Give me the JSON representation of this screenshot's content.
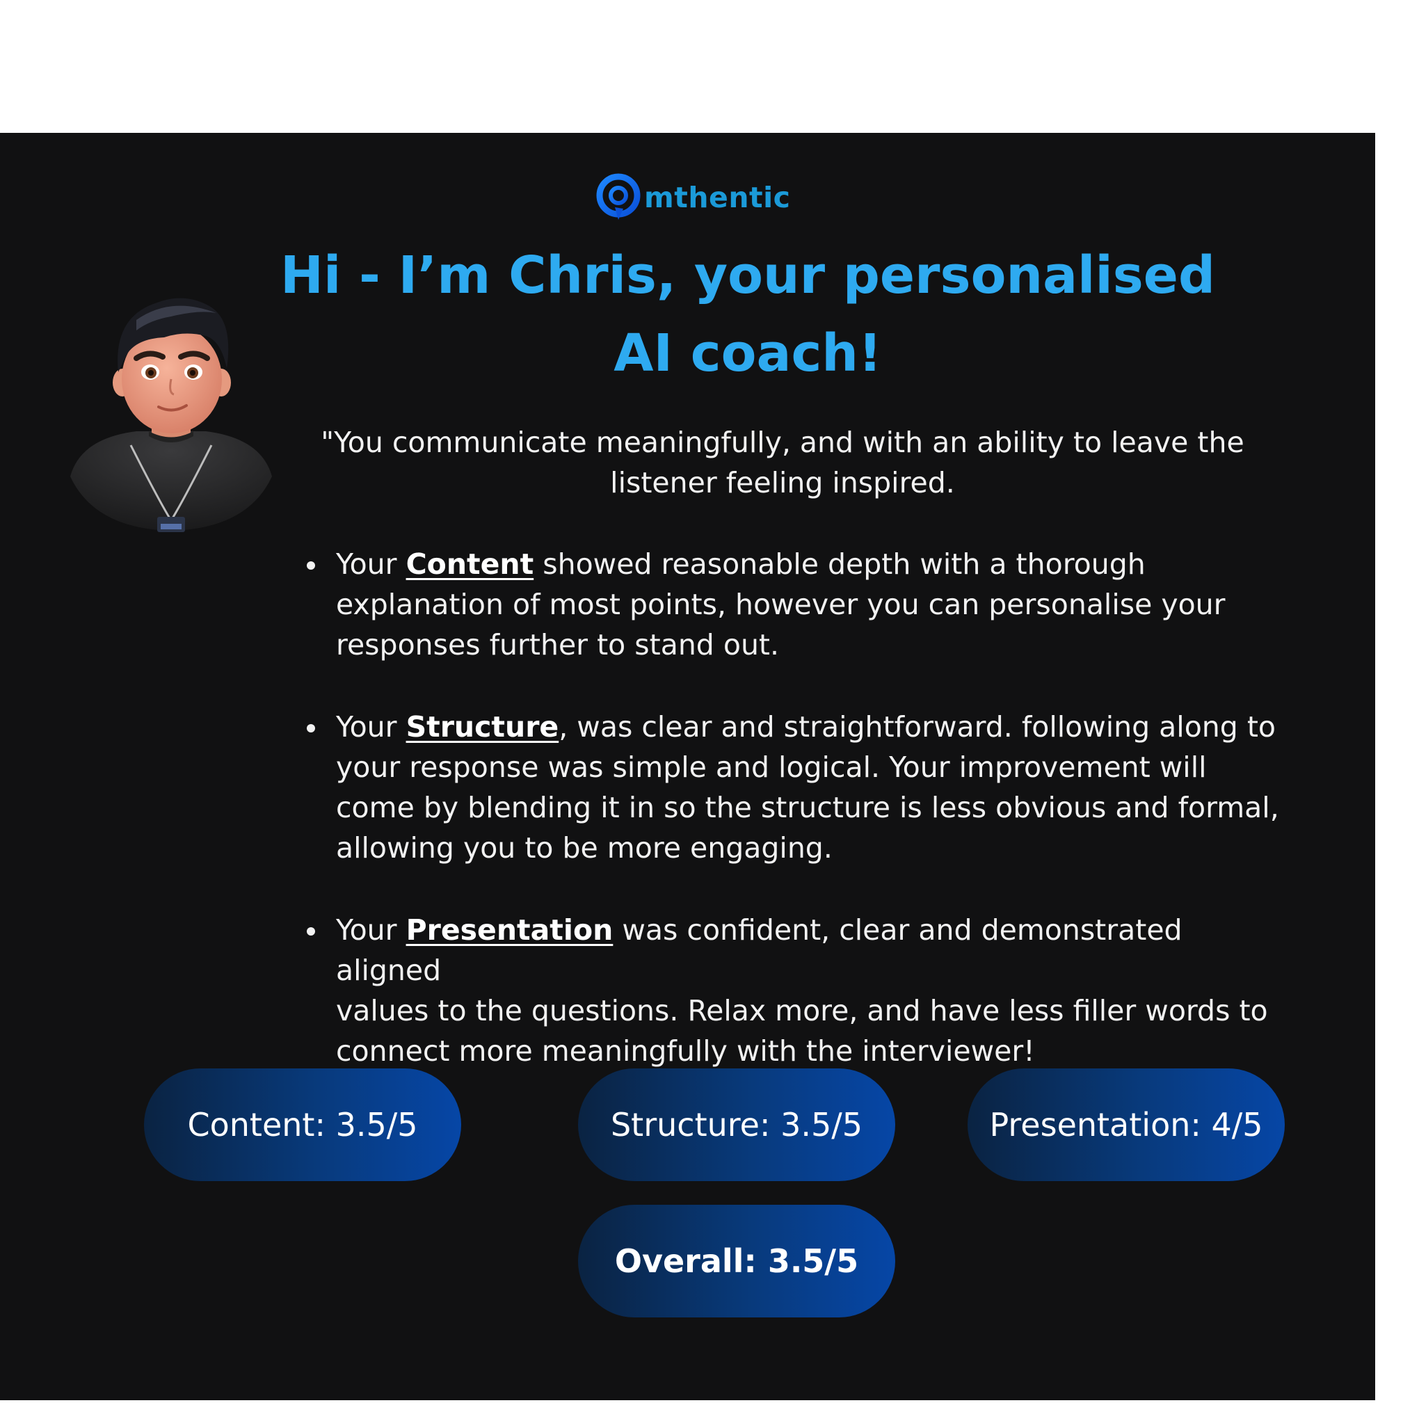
{
  "brand": {
    "name": "mthentic",
    "color": "#1b9ad8"
  },
  "headline": {
    "line1": "Hi - I’m Chris, your personalised",
    "line2": "AI coach!",
    "color": "#2eaaf0"
  },
  "quote": {
    "line1": "\"You communicate meaningfully, and with an ability to leave the",
    "line2": "listener feeling inspired."
  },
  "feedback": [
    {
      "lead": "Your ",
      "keyword": "Content",
      "lines": [
        " showed reasonable depth with a thorough",
        "explanation of most points, however you can personalise your",
        "responses further to stand out."
      ]
    },
    {
      "lead": "Your ",
      "keyword": "Structure",
      "lines": [
        ", was clear and straightforward. following along to",
        "your response was simple and logical. Your improvement will",
        "come by blending it in so the structure is less obvious and formal,",
        "allowing you to be more engaging."
      ]
    },
    {
      "lead": "Your ",
      "keyword": "Presentation",
      "lines": [
        " was confident, clear and demonstrated aligned",
        "values to the questions. Relax more, and have less filler words to",
        "connect more meaningfully with the interviewer!"
      ]
    }
  ],
  "scores": {
    "content": "Content: 3.5/5",
    "structure": "Structure: 3.5/5",
    "presentation": "Presentation: 4/5",
    "overall": "Overall: 3.5/5"
  },
  "icons": {
    "logo": "mthentic-logo-icon",
    "avatar": "coach-avatar"
  }
}
